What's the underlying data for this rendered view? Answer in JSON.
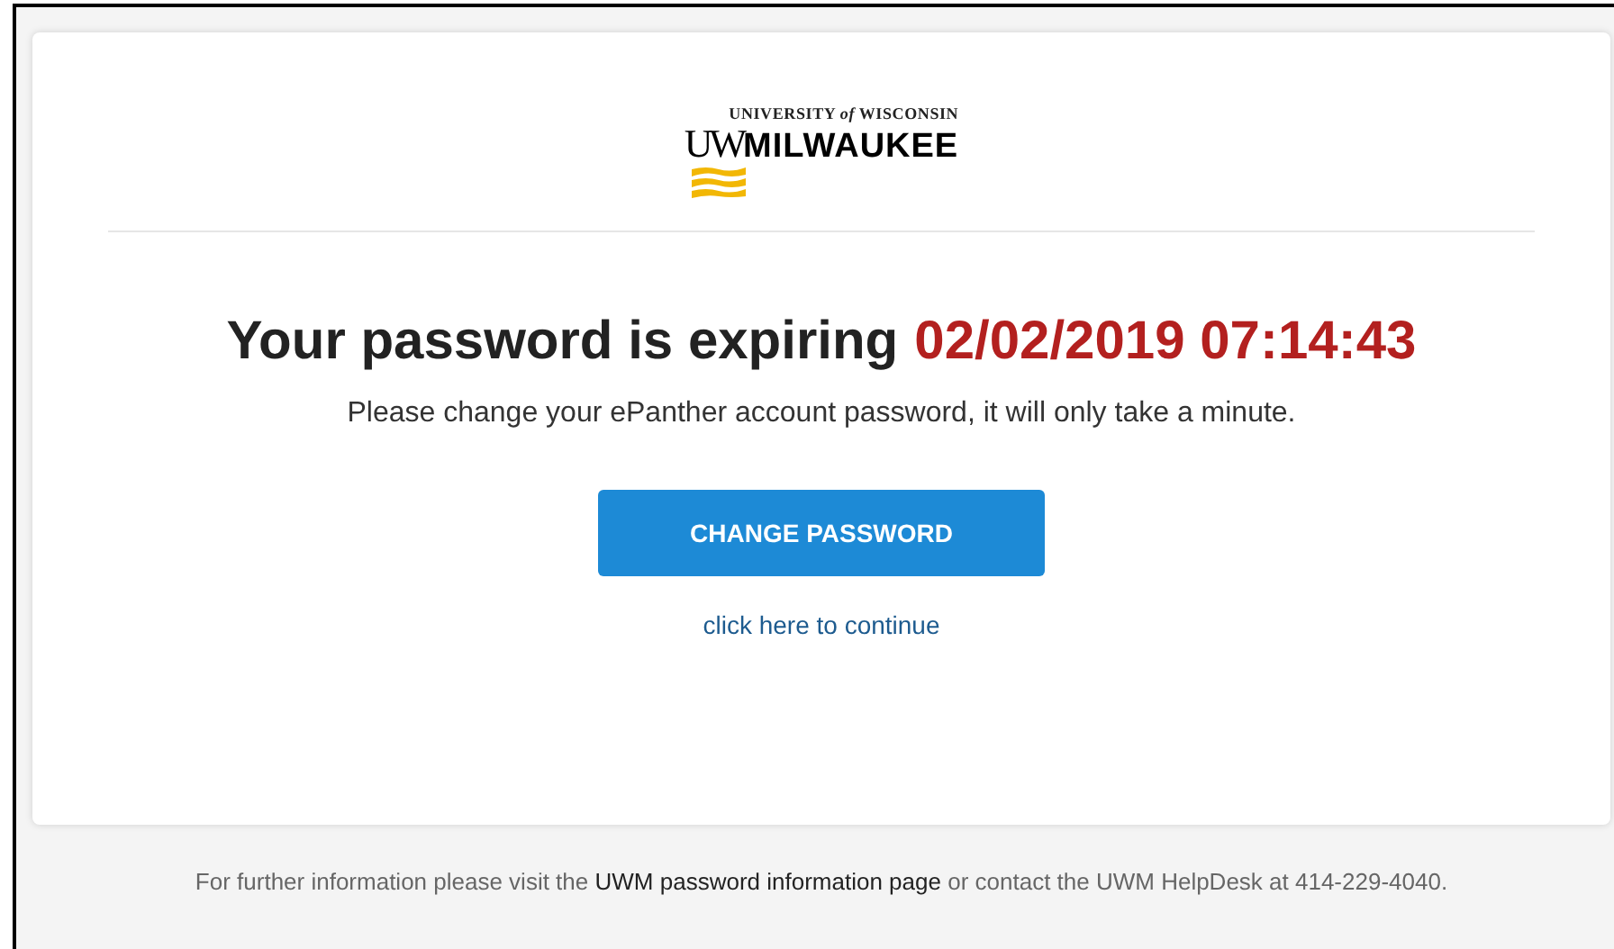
{
  "logo": {
    "top_line": "UNIVERSITY *of* WISCONSIN",
    "initials": "UW",
    "name": "MILWAUKEE"
  },
  "heading": {
    "text": "Your password is expiring",
    "date": "02/02/2019 07:14:43"
  },
  "message": "Please change your ePanther account password, it will only take a minute.",
  "button": "CHANGE PASSWORD",
  "continue_link": "click here to continue",
  "footer": {
    "before": "For further information please visit the",
    "link": "UWM password information page",
    "after": "or contact the UWM HelpDesk at 414-229-4040."
  }
}
